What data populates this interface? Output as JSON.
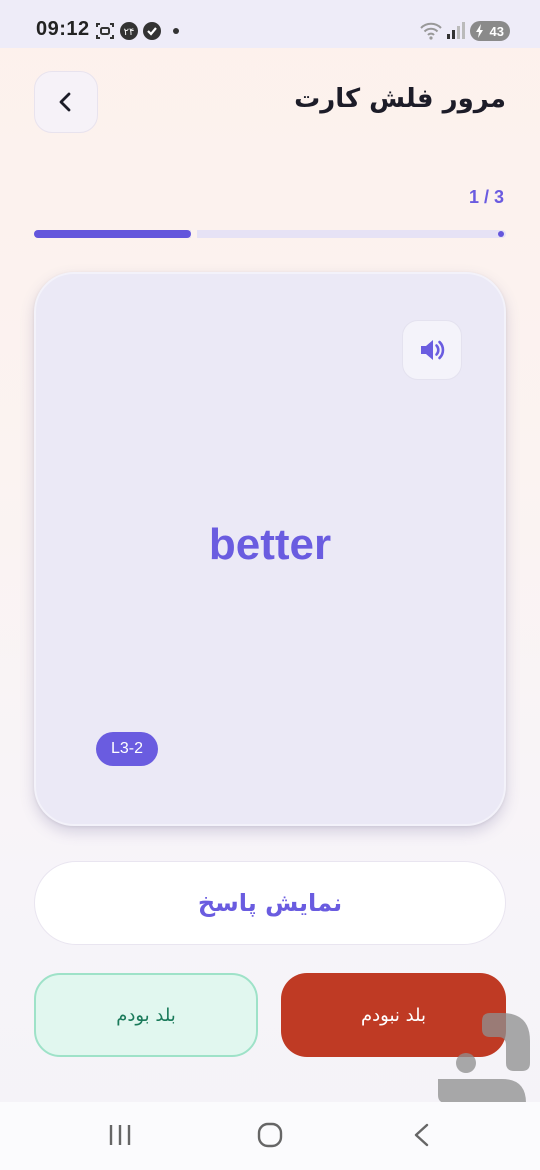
{
  "status_bar": {
    "time": "09:12",
    "battery": "43",
    "icons": [
      "screenshot-icon",
      "notification-badge-icon",
      "shield-check-icon",
      "dot-icon",
      "wifi-icon",
      "signal-icon",
      "battery-icon"
    ]
  },
  "header": {
    "title": "مرور فلش کارت",
    "back_icon": "chevron-left-icon"
  },
  "progress": {
    "counter": "1 / 3",
    "current": 1,
    "total": 3,
    "fraction": 0.333
  },
  "card": {
    "word": "better",
    "level_badge": "L3-2",
    "speaker_icon": "speaker-icon"
  },
  "actions": {
    "show_answer": "نمایش پاسخ",
    "knew": "بلد بودم",
    "didnt_know": "بلد نبودم"
  },
  "nav_bar": {
    "icons": [
      "recents-icon",
      "home-icon",
      "back-icon"
    ]
  },
  "colors": {
    "accent": "#6a5ce0",
    "danger": "#bf3a24",
    "success_bg": "#e1f7ef",
    "success_border": "#9ee2c8"
  }
}
